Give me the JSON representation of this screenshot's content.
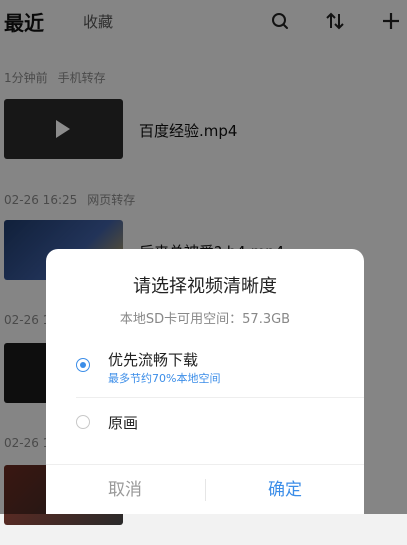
{
  "header": {
    "title": "最近",
    "tab_favorites": "收藏",
    "icons": [
      "search-icon",
      "sort-icon",
      "add-icon"
    ]
  },
  "groups": [
    {
      "time": "1分钟前",
      "source": "手机转存"
    },
    {
      "time": "02-26 16:25",
      "source": "网页转存"
    },
    {
      "time": "02-26 1",
      "source": ""
    },
    {
      "time": "02-26 1",
      "source": ""
    }
  ],
  "items": [
    {
      "name": "百度经验.mp4"
    },
    {
      "name": "后来总被爱? b4.mp4"
    }
  ],
  "dialog": {
    "title": "请选择视频清晰度",
    "storage": "本地SD卡可用空间：57.3GB",
    "options": [
      {
        "label": "优先流畅下载",
        "note": "最多节约70%本地空间",
        "selected": true
      },
      {
        "label": "原画",
        "note": "",
        "selected": false
      }
    ],
    "cancel_label": "取消",
    "confirm_label": "确定"
  },
  "colors": {
    "accent": "#3b8de8"
  }
}
